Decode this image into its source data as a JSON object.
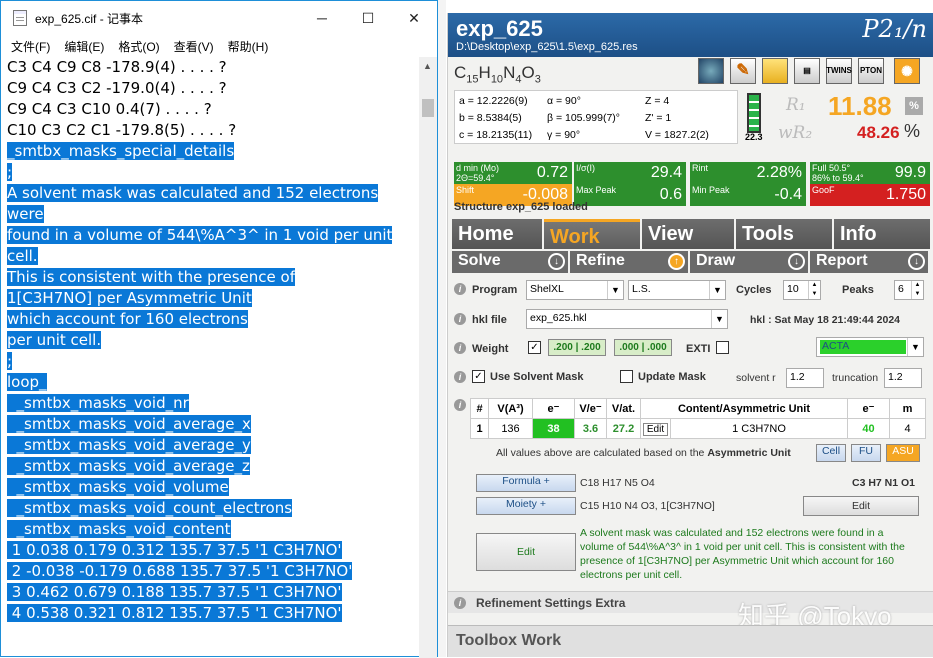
{
  "notepad": {
    "title": "exp_625.cif - 记事本",
    "menu": [
      "文件(F)",
      "编辑(E)",
      "格式(O)",
      "查看(V)",
      "帮助(H)"
    ],
    "lines_plain": [
      "C3 C4 C9 C8 -178.9(4) . . . . ?",
      "C9 C4 C3 C2 -179.0(4) . . . . ?",
      "C9 C4 C3 C10 0.4(7) . . . . ?",
      "C10 C3 C2 C1 -179.8(5) . . . . ?",
      ""
    ],
    "lines_selected": [
      "_smtbx_masks_special_details",
      ";",
      "A solvent mask was calculated and 152 electrons",
      "were",
      "found in a volume of 544\\%A^3^ in 1 void per unit",
      "cell.",
      "This is consistent with the presence of",
      "1[C3H7NO] per Asymmetric Unit",
      "which account for 160 electrons",
      "per unit cell.",
      ";",
      "loop_",
      "  _smtbx_masks_void_nr",
      "  _smtbx_masks_void_average_x",
      "  _smtbx_masks_void_average_y",
      "  _smtbx_masks_void_average_z",
      "  _smtbx_masks_void_volume",
      "  _smtbx_masks_void_count_electrons",
      "  _smtbx_masks_void_content",
      " 1 0.038 0.179 0.312 135.7 37.5 '1 C3H7NO'",
      " 2 -0.038 -0.179 0.688 135.7 37.5 '1 C3H7NO'",
      " 3 0.462 0.679 0.188 135.7 37.5 '1 C3H7NO'",
      " 4 0.538 0.321 0.812 135.7 37.5 '1 C3H7NO'"
    ]
  },
  "olex": {
    "name": "exp_625",
    "path": "D:\\Desktop\\exp_625\\1.5\\exp_625.res",
    "space_group": "P2₁/n",
    "formula": "C15H10N4O3",
    "toolbar": [
      "",
      "",
      "",
      "",
      "TWINS",
      "PTON",
      ""
    ],
    "cell": {
      "a": "a = 12.2226(9)",
      "b": "b = 8.5384(5)",
      "c": "c = 18.2135(11)",
      "alpha": "α = 90°",
      "beta": "β = 105.999(7)°",
      "gamma": "γ = 90°",
      "Z": "Z = 4",
      "Zp": "Z' = 1",
      "V": "V = 1827.2(2)"
    },
    "battery": "22.3",
    "R1_label": "R₁",
    "R1": "11.88",
    "wR2_label": "wR₂",
    "wR2": "48.26",
    "pct": "%",
    "stats": [
      {
        "label": "d min (Mo)\n2Θ=59.4°",
        "value": "0.72",
        "color": "#2d8f2d"
      },
      {
        "label": "I/σ(I)",
        "value": "29.4",
        "color": "#2d8f2d"
      },
      {
        "label": "Rint",
        "value": "2.28%",
        "color": "#2d8f2d"
      },
      {
        "label": "Full 50.5°\n86% to 59.4°",
        "value": "99.9",
        "color": "#2d8f2d"
      },
      {
        "label": "Shift",
        "value": "-0.008",
        "color": "#f5a623"
      },
      {
        "label": "Max Peak",
        "value": "0.6",
        "color": "#2d8f2d"
      },
      {
        "label": "Min Peak",
        "value": "-0.4",
        "color": "#2d8f2d"
      },
      {
        "label": "GooF",
        "value": "1.750",
        "color": "#d42020"
      }
    ],
    "loaded": "Structure exp_625 loaded",
    "tabs": [
      "Home",
      "Work",
      "View",
      "Tools",
      "Info"
    ],
    "subtabs": [
      "Solve",
      "Refine",
      "Draw",
      "Report"
    ],
    "program_label": "Program",
    "program": "ShelXL",
    "method": "L.S.",
    "cycles_label": "Cycles",
    "cycles": "10",
    "peaks_label": "Peaks",
    "peaks": "6",
    "hkl_label": "hkl file",
    "hkl": "exp_625.hkl",
    "hkl_date": "hkl : Sat May 18 21:49:44 2024",
    "weight_label": "Weight",
    "w1": ".200 | .200",
    "w2": ".000 | .000",
    "exti": "EXTI",
    "acta": "ACTA",
    "solvent_mask": "Use Solvent Mask",
    "update_mask": "Update Mask",
    "solvent_r_label": "solvent r",
    "solvent_r": "1.2",
    "trunc_label": "truncation",
    "trunc": "1.2",
    "table_head": [
      "#",
      "V(A³)",
      "e⁻",
      "V/e⁻",
      "V/at.",
      "Content/Asymmetric Unit",
      "e⁻",
      "m"
    ],
    "table_row": [
      "1",
      "136",
      "38",
      "3.6",
      "27.2",
      "Edit",
      "1 C3H7NO",
      "40",
      "4"
    ],
    "asu_note_pre": "All values above are calculated based on the",
    "asu_note_bold": "Asymmetric Unit",
    "asu_btns": [
      "Cell",
      "FU",
      "ASU"
    ],
    "formula_btn": "Formula +",
    "formula_text": "C18 H17 N5 O4",
    "formula_right": "C3 H7 N1 O1",
    "moiety_btn": "Moiety +",
    "moiety_text": "C15 H10 N4 O3, 1[C3H7NO]",
    "moiety_edit": "Edit",
    "edit_btn": "Edit",
    "details": "A solvent mask was calculated and 152 electrons were found in a volume of 544\\%A^3^ in 1 void per unit cell. This is consistent with the presence of 1[C3H7NO] per Asymmetric Unit which account for 160 electrons per unit cell.",
    "refine_extra": "Refinement Settings Extra",
    "toolbox": "Toolbox Work",
    "watermark": "知乎 @Tokyo"
  }
}
